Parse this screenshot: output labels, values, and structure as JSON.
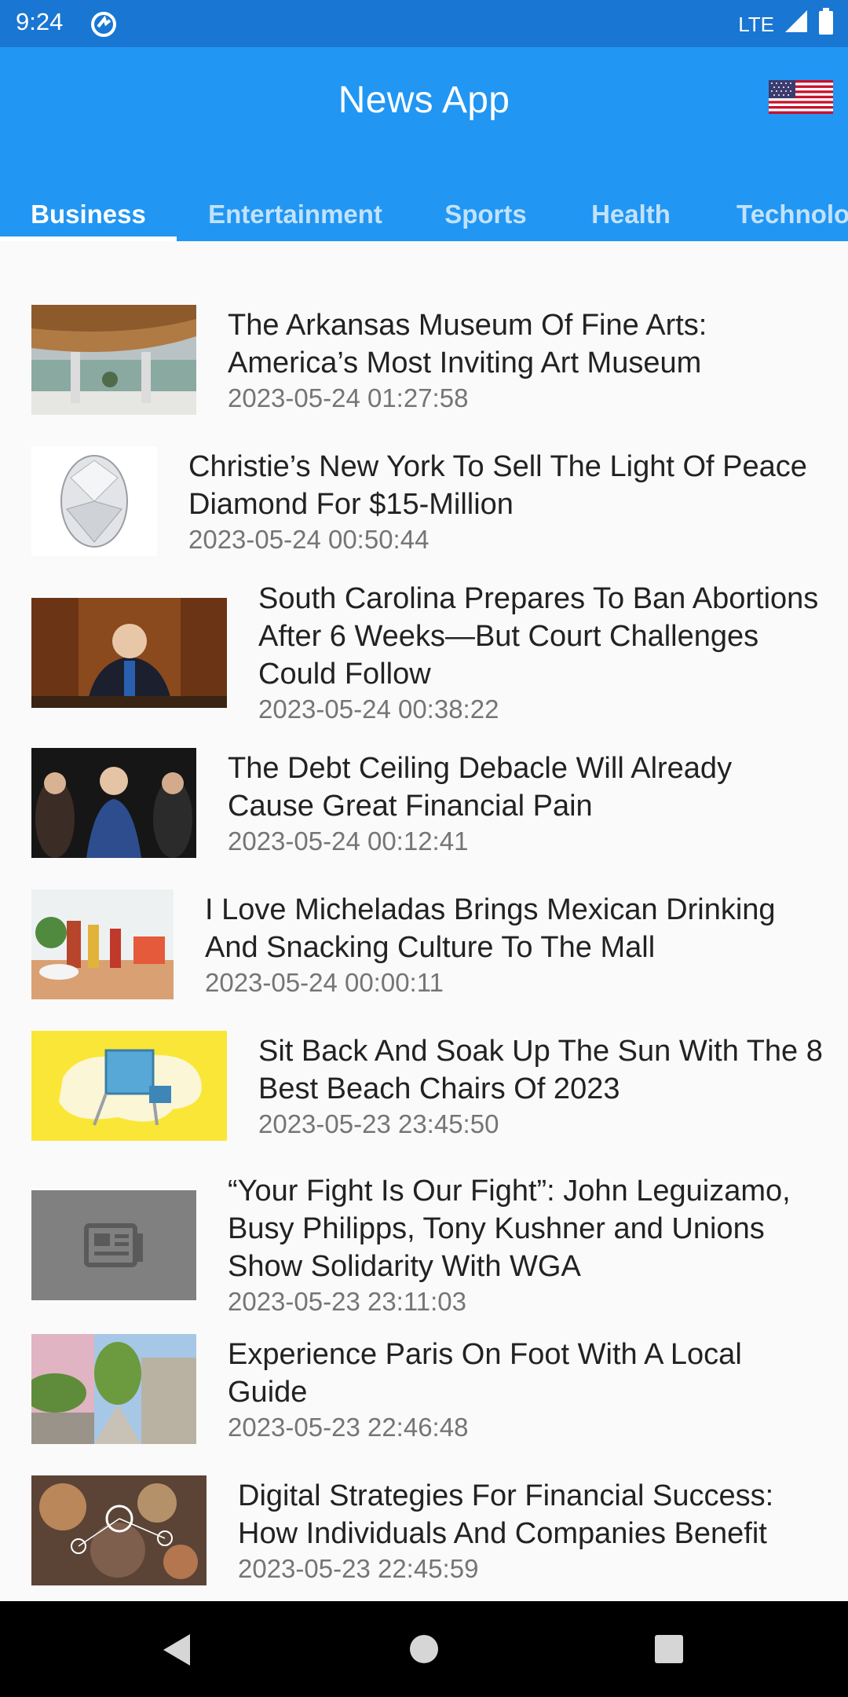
{
  "status_bar": {
    "time": "9:24",
    "network": "LTE"
  },
  "app_bar": {
    "title": "News App",
    "country_flag_icon": "us-flag-icon"
  },
  "tabs": [
    {
      "label": "Business",
      "active": true
    },
    {
      "label": "Entertainment",
      "active": false
    },
    {
      "label": "Sports",
      "active": false
    },
    {
      "label": "Health",
      "active": false
    },
    {
      "label": "Technology",
      "active": false
    }
  ],
  "articles": [
    {
      "title": "The Arkansas Museum Of Fine Arts: America’s Most Inviting Art Museum",
      "date": "2023-05-24 01:27:58"
    },
    {
      "title": "Christie’s New York To Sell The Light Of Peace Diamond For $15-Million",
      "date": "2023-05-24 00:50:44"
    },
    {
      "title": "South Carolina Prepares To Ban Abortions After 6 Weeks—But Court Challenges Could Follow",
      "date": "2023-05-24 00:38:22"
    },
    {
      "title": "The Debt Ceiling Debacle Will Already Cause Great Financial Pain",
      "date": "2023-05-24 00:12:41"
    },
    {
      "title": "I Love Micheladas Brings Mexican Drinking And Snacking Culture To The Mall",
      "date": "2023-05-24 00:00:11"
    },
    {
      "title": "Sit Back And Soak Up The Sun With The 8 Best Beach Chairs Of 2023",
      "date": "2023-05-23 23:45:50"
    },
    {
      "title": "“Your Fight Is Our Fight”: John Leguizamo, Busy Philipps, Tony Kushner and Unions Show Solidarity With WGA",
      "date": "2023-05-23 23:11:03"
    },
    {
      "title": "Experience Paris On Foot With A Local Guide",
      "date": "2023-05-23 22:46:48"
    },
    {
      "title": "Digital Strategies For Financial Success: How Individuals And Companies Benefit",
      "date": "2023-05-23 22:45:59"
    }
  ],
  "colors": {
    "primary": "#2196f3",
    "status_bar": "#1976d2",
    "headline_text": "#222222",
    "date_text": "#757575"
  }
}
